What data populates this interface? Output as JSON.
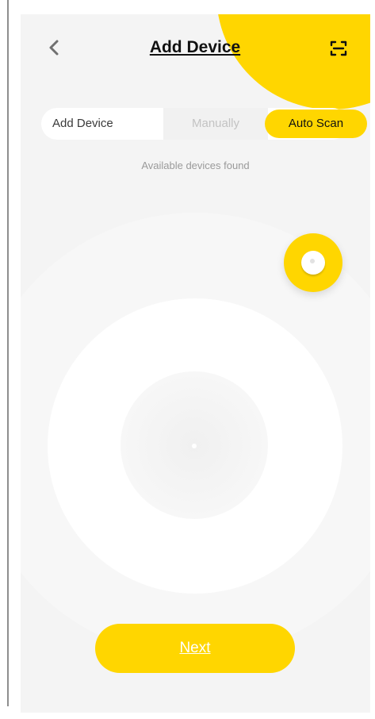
{
  "header": {
    "title": "Add Device",
    "back_icon": "chevron-left-icon",
    "scan_icon": "scan-icon"
  },
  "tabs": {
    "label": "Add Device",
    "items": [
      {
        "label": "Manually",
        "selected": false
      },
      {
        "label": "Auto Scan",
        "selected": true
      }
    ]
  },
  "status": {
    "found_text": "Available devices found"
  },
  "device": {
    "icon": "device-puck-icon"
  },
  "footer": {
    "next_label": "Next"
  },
  "colors": {
    "accent": "#ffd600",
    "background": "#f4f4f4",
    "text_primary": "#111111",
    "text_muted": "#9a9a9a",
    "tab_inactive_text": "#c3c3c3"
  }
}
